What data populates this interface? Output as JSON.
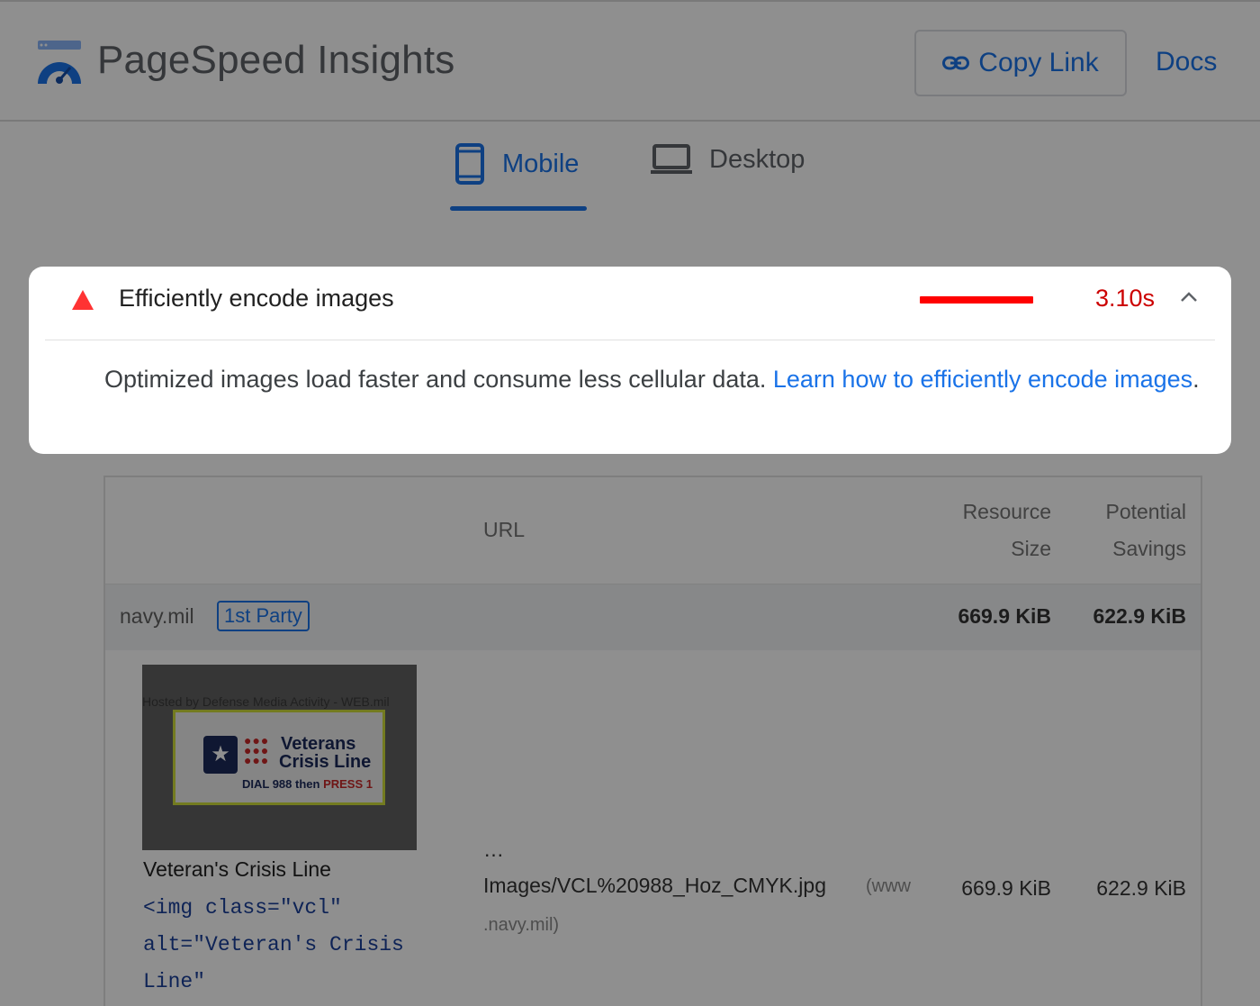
{
  "header": {
    "app_title": "PageSpeed Insights",
    "logo_icon": "pagespeed-logo-icon",
    "copy_link_label": "Copy Link",
    "copy_link_icon": "link-icon",
    "docs_label": "Docs"
  },
  "tabs": [
    {
      "label": "Mobile",
      "icon": "mobile-phone-icon",
      "active": true
    },
    {
      "label": "Desktop",
      "icon": "laptop-icon",
      "active": false
    }
  ],
  "audit": {
    "title": "Efficiently encode images",
    "status_icon": "warning-triangle-icon",
    "value": "3.10s",
    "expanded": true,
    "description_text": "Optimized images load faster and consume less cellular data. ",
    "learn_more_label": "Learn how to efficiently encode images",
    "description_end": "."
  },
  "table": {
    "columns": {
      "url": "URL",
      "resource_size_line1": "Resource",
      "resource_size_line2": "Size",
      "potential_savings_line1": "Potential",
      "potential_savings_line2": "Savings"
    },
    "group": {
      "name": "navy.mil",
      "badge": "1st Party",
      "resource_size": "669.9 KiB",
      "potential_savings": "622.9 KiB"
    },
    "rows": [
      {
        "thumbnail_caption": "Hosted by Defense Media Activity - WEB.mil",
        "thumbnail_logo": {
          "line1": "Veterans",
          "line2": "Crisis Line",
          "line3_prefix": "DIAL 988 then ",
          "line3_press": "PRESS",
          "line3_num": "1"
        },
        "node_label": "Veteran's Crisis Line",
        "node_snippet": "<img class=\"vcl\"\nalt=\"Veteran's Crisis\nLine\"",
        "url_ellipsis": "…",
        "url_path": "Images/VCL%20988_Hoz_CMYK.jpg",
        "url_host_part1": "(www",
        "url_host_part2": ".navy.mil)",
        "resource_size": "669.9 KiB",
        "potential_savings": "622.9 KiB"
      }
    ]
  },
  "colors": {
    "accent": "#1a73e8",
    "fail": "#cc0000",
    "fail_bar": "#ff0000"
  }
}
